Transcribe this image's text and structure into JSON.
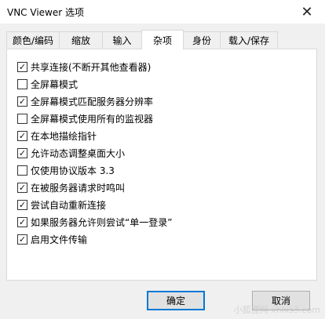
{
  "window": {
    "title": "VNC Viewer 选项",
    "close_glyph": "✕"
  },
  "tabs": [
    {
      "label": "颜色/编码"
    },
    {
      "label": "缩放"
    },
    {
      "label": "输入"
    },
    {
      "label": "杂项"
    },
    {
      "label": "身份"
    },
    {
      "label": "载入/保存"
    }
  ],
  "active_tab": "杂项",
  "options": [
    {
      "label": "共享连接(不断开其他查看器)",
      "checked": true
    },
    {
      "label": "全屏幕模式",
      "checked": false
    },
    {
      "label": "全屏幕模式匹配服务器分辨率",
      "checked": true
    },
    {
      "label": "全屏幕模式使用所有的监视器",
      "checked": false
    },
    {
      "label": "在本地描绘指针",
      "checked": true
    },
    {
      "label": "允许动态调整桌面大小",
      "checked": true
    },
    {
      "label": "仅使用协议版本 3.3",
      "checked": false
    },
    {
      "label": "在被服务器请求时鸣叫",
      "checked": true
    },
    {
      "label": "尝试自动重新连接",
      "checked": true
    },
    {
      "label": "如果服务器允许则尝试“单一登录”",
      "checked": true
    },
    {
      "label": "启用文件传输",
      "checked": true
    }
  ],
  "buttons": {
    "ok": "确定",
    "cancel": "取消"
  },
  "watermark": "小狐狸网 xhlxs3.com",
  "colors": {
    "focus_border": "#0078d7",
    "panel_bg": "#ffffff",
    "dialog_bg": "#f0f0f0"
  }
}
